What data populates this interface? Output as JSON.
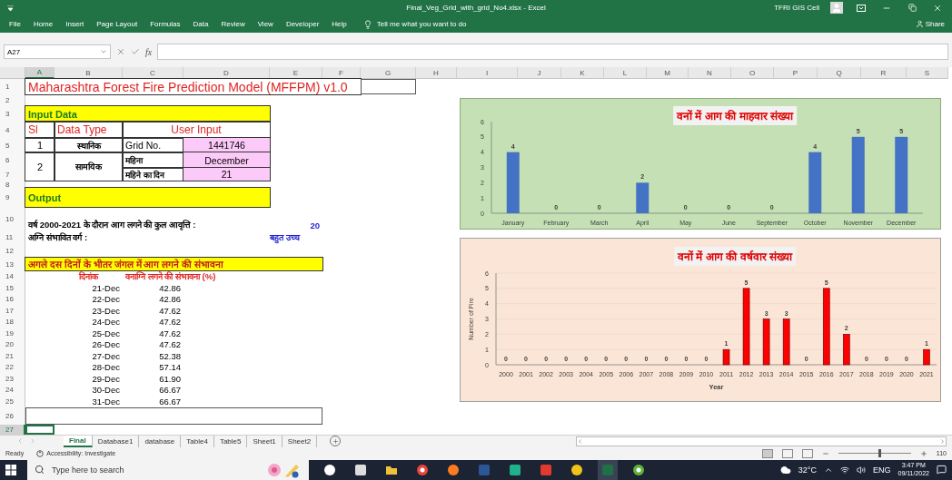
{
  "window": {
    "title": "Final_Veg_Grid_with_grid_No4.xlsx  -  Excel",
    "user": "TFRI GIS Cell"
  },
  "ribbon": {
    "tabs": [
      "File",
      "Home",
      "Insert",
      "Page Layout",
      "Formulas",
      "Data",
      "Review",
      "View",
      "Developer",
      "Help"
    ],
    "tell_me": "Tell me what you want to do",
    "share": "Share"
  },
  "formula_bar": {
    "name_box": "A27",
    "function_label": "fx"
  },
  "sheet": {
    "column_headers": [
      {
        "label": "A",
        "selected": true
      },
      {
        "label": "B",
        "selected": false
      },
      {
        "label": "C",
        "selected": false
      },
      {
        "label": "D",
        "selected": false
      },
      {
        "label": "E",
        "selected": false
      },
      {
        "label": "F",
        "selected": false
      },
      {
        "label": "G",
        "selected": false
      },
      {
        "label": "H",
        "selected": false
      },
      {
        "label": "I",
        "selected": false
      },
      {
        "label": "J",
        "selected": false
      },
      {
        "label": "K",
        "selected": false
      },
      {
        "label": "L",
        "selected": false
      },
      {
        "label": "M",
        "selected": false
      },
      {
        "label": "N",
        "selected": false
      },
      {
        "label": "O",
        "selected": false
      },
      {
        "label": "P",
        "selected": false
      },
      {
        "label": "Q",
        "selected": false
      },
      {
        "label": "R",
        "selected": false
      },
      {
        "label": "S",
        "selected": false
      }
    ],
    "row_numbers": [
      {
        "label": "1",
        "selected": false
      },
      {
        "label": "2",
        "selected": false
      },
      {
        "label": "3",
        "selected": false
      },
      {
        "label": "4",
        "selected": false
      },
      {
        "label": "5",
        "selected": false
      },
      {
        "label": "6",
        "selected": false
      },
      {
        "label": "7",
        "selected": false
      },
      {
        "label": "8",
        "selected": false
      },
      {
        "label": "9",
        "selected": false
      },
      {
        "label": "10",
        "selected": false
      },
      {
        "label": "11",
        "selected": false
      },
      {
        "label": "12",
        "selected": false
      },
      {
        "label": "13",
        "selected": false
      },
      {
        "label": "14",
        "selected": false
      },
      {
        "label": "15",
        "selected": false
      },
      {
        "label": "16",
        "selected": false
      },
      {
        "label": "17",
        "selected": false
      },
      {
        "label": "18",
        "selected": false
      },
      {
        "label": "19",
        "selected": false
      },
      {
        "label": "20",
        "selected": false
      },
      {
        "label": "21",
        "selected": false
      },
      {
        "label": "22",
        "selected": false
      },
      {
        "label": "23",
        "selected": false
      },
      {
        "label": "24",
        "selected": false
      },
      {
        "label": "25",
        "selected": false
      },
      {
        "label": "26",
        "selected": false
      },
      {
        "label": "27",
        "selected": true
      }
    ]
  },
  "model_title": "Maharashtra Forest Fire Prediction Model (MFFPM) v1.0",
  "input_data": {
    "heading": "Input Data",
    "columns": [
      "Sl",
      "Data Type",
      "User Input"
    ],
    "rows": [
      {
        "sl": "1",
        "data_type": "स्थानिक",
        "fields": [
          {
            "label": "Grid No.",
            "value": "1441746"
          }
        ]
      },
      {
        "sl": "2",
        "data_type": "सामयिक",
        "fields": [
          {
            "label": "महिना",
            "value": "December"
          },
          {
            "label": "महिने का दिन",
            "value": "21"
          }
        ]
      }
    ]
  },
  "output": {
    "heading": "Output",
    "total_label": "वर्ष 2000-2021 के दौरान आग लगने की कुल आवृत्ति :",
    "total_value": "20",
    "class_label": "अग्नि संभावित वर्ग :",
    "class_value": "बहुत उच्च"
  },
  "forecast": {
    "heading": "अगले दस दिनों के भीतर जंगल में आग लगने की संभावना",
    "columns": [
      "दिनांक",
      "वनाग्नि लगने की संभावना (%)"
    ],
    "rows": [
      {
        "date": "21-Dec",
        "probability": "42.86"
      },
      {
        "date": "22-Dec",
        "probability": "42.86"
      },
      {
        "date": "23-Dec",
        "probability": "47.62"
      },
      {
        "date": "24-Dec",
        "probability": "47.62"
      },
      {
        "date": "25-Dec",
        "probability": "47.62"
      },
      {
        "date": "26-Dec",
        "probability": "47.62"
      },
      {
        "date": "27-Dec",
        "probability": "52.38"
      },
      {
        "date": "28-Dec",
        "probability": "57.14"
      },
      {
        "date": "29-Dec",
        "probability": "61.90"
      },
      {
        "date": "30-Dec",
        "probability": "66.67"
      },
      {
        "date": "31-Dec",
        "probability": "66.67"
      }
    ]
  },
  "monthly_chart": {
    "chart_data": {
      "type": "bar",
      "title": "वनों में आग की माहवार संख्या",
      "categories": [
        "January",
        "February",
        "March",
        "April",
        "May",
        "June",
        "September",
        "October",
        "November",
        "December"
      ],
      "series": [
        {
          "color": "#4472c4",
          "values": [
            4,
            0,
            0,
            2,
            0,
            0,
            0,
            4,
            5,
            5
          ]
        }
      ],
      "ylim": [
        0,
        6
      ],
      "yticks": [
        0,
        1,
        2,
        3,
        4,
        5,
        6
      ],
      "data_labels": true
    }
  },
  "yearly_chart": {
    "chart_data": {
      "type": "bar",
      "title": "वनों में आग की वर्षवार संख्या",
      "xlabel": "Year",
      "ylabel": "Number of Fire",
      "categories": [
        "2000",
        "2001",
        "2002",
        "2003",
        "2004",
        "2005",
        "2006",
        "2007",
        "2008",
        "2009",
        "2010",
        "2011",
        "2012",
        "2013",
        "2014",
        "2015",
        "2016",
        "2017",
        "2018",
        "2019",
        "2020",
        "2021"
      ],
      "series": [
        {
          "color": "#ff0000",
          "values": [
            0,
            0,
            0,
            0,
            0,
            0,
            0,
            0,
            0,
            0,
            0,
            1,
            5,
            3,
            3,
            0,
            5,
            2,
            0,
            0,
            0,
            1
          ]
        }
      ],
      "ylim": [
        0,
        6
      ],
      "yticks": [
        0,
        1,
        2,
        3,
        4,
        5,
        6
      ],
      "grid": true,
      "data_labels": true
    }
  },
  "sheet_tabs": [
    {
      "label": "Final",
      "selected": true
    },
    {
      "label": "Database1",
      "selected": false
    },
    {
      "label": "database",
      "selected": false
    },
    {
      "label": "Table4",
      "selected": false
    },
    {
      "label": "Table5",
      "selected": false
    },
    {
      "label": "Sheet1",
      "selected": false
    },
    {
      "label": "Sheet2",
      "selected": false
    }
  ],
  "status_bar": {
    "mode": "Ready",
    "accessibility": "Accessibility: Investigate",
    "zoom": {
      "level": 0.55,
      "reading": "110"
    }
  },
  "taskbar": {
    "search_placeholder": "Type here to search",
    "temperature": "32°C",
    "language": "ENG",
    "time": "3:47 PM",
    "date": "09/11/2022"
  }
}
